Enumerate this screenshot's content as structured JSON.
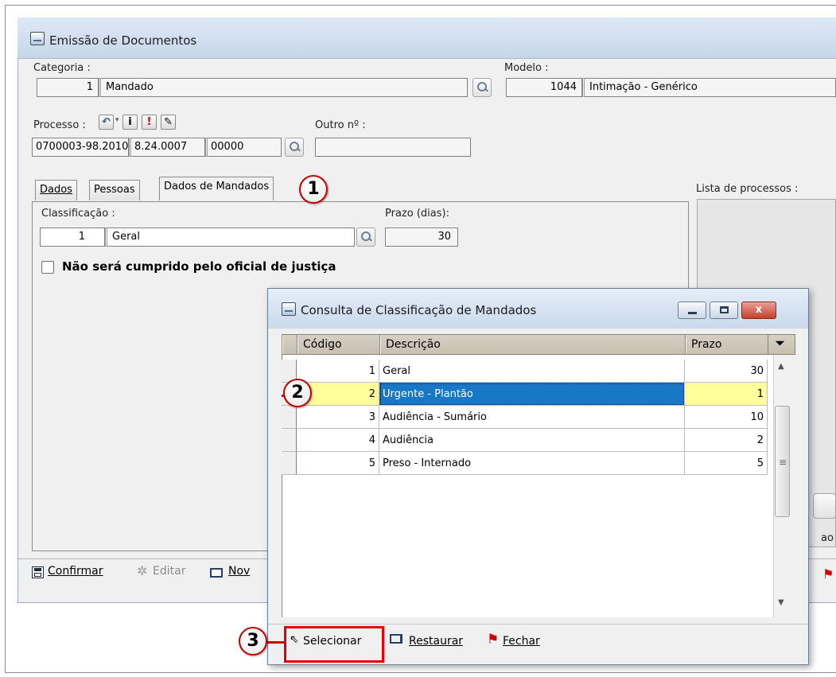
{
  "main_window": {
    "title": "Emissão de Documentos",
    "categoria": {
      "label": "Categoria :",
      "code": "1",
      "name": "Mandado"
    },
    "modelo": {
      "label": "Modelo :",
      "code": "1044",
      "name": "Intimação - Genérico"
    },
    "processo": {
      "label": "Processo :",
      "part1": "0700003-98.2010",
      "part2": "8.24.0007",
      "part3": "00000",
      "info_glyph": "i",
      "alert_glyph": "!"
    },
    "outro": {
      "label": "Outro nº :",
      "value": ""
    },
    "tabs": [
      {
        "label": "Dados",
        "state": "inactive"
      },
      {
        "label": "Pessoas",
        "state": "inactive"
      },
      {
        "label": "Dados de Mandados",
        "state": "active"
      }
    ],
    "classificacao": {
      "label": "Classificação :",
      "code": "1",
      "name": "Geral"
    },
    "prazo": {
      "label": "Prazo (dias):",
      "value": "30"
    },
    "checkbox_label": "Não será cumprido pelo oficial de justiça",
    "checkbox_checked": false,
    "lista_label": "Lista de processos :",
    "partial_text": "ao re",
    "footer": {
      "confirmar": "Confirmar",
      "editar": "Editar",
      "novo": "Nov"
    }
  },
  "dialog": {
    "title": "Consulta de Classificação de Mandados",
    "columns": {
      "codigo": "Código",
      "descricao": "Descrição",
      "prazo": "Prazo"
    },
    "rows": [
      {
        "codigo": "1",
        "descricao": "Geral",
        "prazo": "30",
        "selected": false
      },
      {
        "codigo": "2",
        "descricao": "Urgente - Plantão",
        "prazo": "1",
        "selected": true
      },
      {
        "codigo": "3",
        "descricao": "Audiência - Sumário",
        "prazo": "10",
        "selected": false
      },
      {
        "codigo": "4",
        "descricao": "Audiência",
        "prazo": "2",
        "selected": false
      },
      {
        "codigo": "5",
        "descricao": "Preso - Internado",
        "prazo": "5",
        "selected": false
      }
    ],
    "footer": {
      "selecionar": "Selecionar",
      "restaurar": "Restaurar",
      "fechar": "Fechar"
    },
    "close_glyph": "x"
  },
  "callouts": {
    "one": "1",
    "two": "2",
    "three": "3"
  },
  "colors": {
    "selection_blue": "#1778c7",
    "selection_yellow": "#ffff9c",
    "callout_red": "#c40000"
  }
}
